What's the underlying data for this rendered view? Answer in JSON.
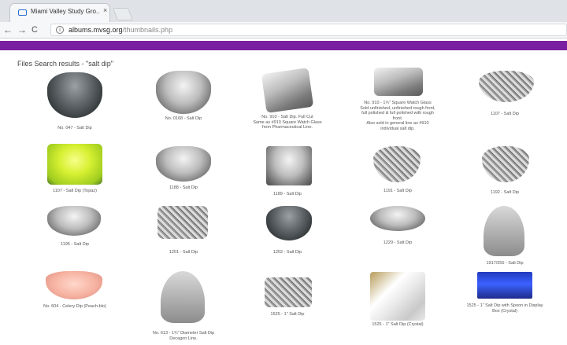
{
  "browser": {
    "tab_title": "Miami Valley Study Gro...",
    "tab_close": "×",
    "nav_back": "←",
    "nav_forward": "→",
    "nav_reload": "C",
    "address_info": "i",
    "address_host": "albums.mvsg.org",
    "address_path": "/thumbnails.php"
  },
  "page": {
    "results_label": "Files Search results - \"salt dip\""
  },
  "items": [
    {
      "caption": "No. 047 - Salt Dip"
    },
    {
      "caption": "No. 0168 - Salt Dip"
    },
    {
      "caption": "No. 910 - Salt Dip. Full Cut\nSame as #910 Square Watch Glass\nfrom Pharmaceutical Line."
    },
    {
      "caption": "No. 910 - 1¾\" Square Watch Glass\nSold unfinished, unfinished rough front,\nfull polished & full polished with rough\nfront.\nAlso sold in general line as #910\nindividual salt dip."
    },
    {
      "caption": "1107 - Salt Dip"
    },
    {
      "caption": "1107 - Salt Dip (Topaz)"
    },
    {
      "caption": "1188 - Salt Dip"
    },
    {
      "caption": "1189 - Salt Dip"
    },
    {
      "caption": "1191 - Salt Dip"
    },
    {
      "caption": "1192 - Salt Dip"
    },
    {
      "caption": "1195 - Salt Dip"
    },
    {
      "caption": "1201 - Salt Dip"
    },
    {
      "caption": "1202 - Salt Dip"
    },
    {
      "caption": "1229 - Salt Dip"
    },
    {
      "caption": "1917/255 - Salt Dip"
    },
    {
      "caption": "No. 604 - Celery Dip (Peach-blo)"
    },
    {
      "caption": "No. 613 - 1¾\" Diameter Salt Dip\nDecagon Line."
    },
    {
      "caption": "1525 - 1\" Salt Dip"
    },
    {
      "caption": "1525 - 1\" Salt Dip (Crystal)"
    },
    {
      "caption": "1525 - 1\" Salt Dip with Spoon in Display\nBox (Crystal)"
    }
  ]
}
